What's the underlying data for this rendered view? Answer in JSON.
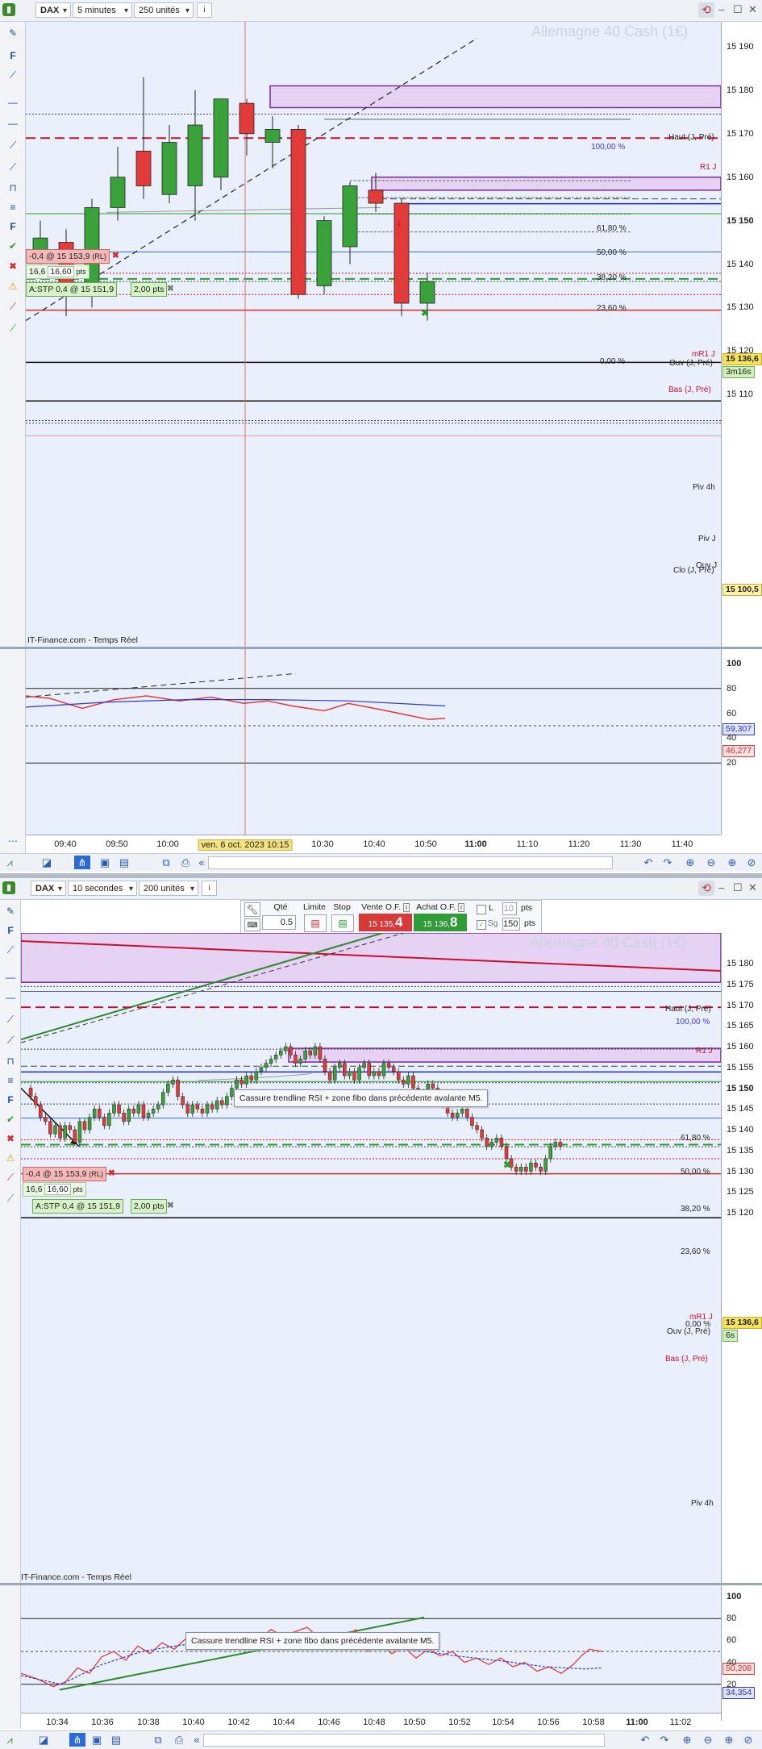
{
  "top": {
    "instrument": "DAX",
    "timeframe": "5 minutes",
    "units": "250 unités",
    "watermark": "Allemagne 40 Cash (1€)",
    "source": "IT-Finance.com - Temps Réel",
    "y_labels": [
      "15 190",
      "15 180",
      "15 170",
      "15 160",
      "15 150",
      "15 140",
      "15 130",
      "15 120",
      "15 110"
    ],
    "price_tag": "15 136,6",
    "timer_tag": "3m16s",
    "low_tag": "15 100,5",
    "levels": {
      "haut": "Haut (J, Pré)",
      "r1": "R1 J",
      "mr1": "mR1 J",
      "ouv": "Ouv (J, Pré)",
      "bas": "Bas (J, Pré)",
      "piv4h": "Piv 4h",
      "pivj": "Piv J",
      "clo": "Clo (J, Pré)",
      "ouvj": "Ouv J"
    },
    "fibo": [
      "100,00 %",
      "61,80 %",
      "50,00 %",
      "38,20 %",
      "23,60 %",
      "0,00 %"
    ],
    "order1": {
      "text": "-0,4 @ 15 153,9",
      "tag": "(RL)"
    },
    "order1b": {
      "a": "16,6",
      "b": "16,60",
      "unit": "pts"
    },
    "order2": {
      "text": "A:STP 0,4 @ 15 151,9",
      "pts": "2,00 pts"
    },
    "rsi_labels": [
      "100",
      "80",
      "60",
      "40",
      "20"
    ],
    "rsi_tags": [
      "59,307",
      "46,277"
    ],
    "x_labels": [
      "09:40",
      "09:50",
      "10:00",
      "10:30",
      "10:40",
      "10:50",
      "11:00",
      "11:10",
      "11:20",
      "11:30",
      "11:40"
    ],
    "x_cursor": "ven. 6 oct. 2023 10:15",
    "chart_data": {
      "type": "candlestick",
      "candles": [
        {
          "o": 15142,
          "h": 15150,
          "l": 15140,
          "c": 15146
        },
        {
          "o": 15145,
          "h": 15148,
          "l": 15128,
          "c": 15133
        },
        {
          "o": 15133,
          "h": 15155,
          "l": 15130,
          "c": 15153
        },
        {
          "o": 15153,
          "h": 15167,
          "l": 15150,
          "c": 15160
        },
        {
          "o": 15166,
          "h": 15183,
          "l": 15155,
          "c": 15158
        },
        {
          "o": 15156,
          "h": 15172,
          "l": 15154,
          "c": 15168
        },
        {
          "o": 15158,
          "h": 15180,
          "l": 15150,
          "c": 15172
        },
        {
          "o": 15160,
          "h": 15177,
          "l": 15157,
          "c": 15178
        },
        {
          "o": 15177,
          "h": 15178,
          "l": 15165,
          "c": 15170
        },
        {
          "o": 15168,
          "h": 15174,
          "l": 15162,
          "c": 15171
        },
        {
          "o": 15171,
          "h": 15172,
          "l": 15132,
          "c": 15133
        },
        {
          "o": 15135,
          "h": 15151,
          "l": 15133,
          "c": 15150
        },
        {
          "o": 15144,
          "h": 15159,
          "l": 15140,
          "c": 15158
        },
        {
          "o": 15157,
          "h": 15161,
          "l": 15152,
          "c": 15154
        },
        {
          "o": 15154,
          "h": 15155,
          "l": 15128,
          "c": 15131
        },
        {
          "o": 15131,
          "h": 15138,
          "l": 15127,
          "c": 15136
        }
      ]
    }
  },
  "bottom": {
    "instrument": "DAX",
    "timeframe": "10 secondes",
    "units": "200 unités",
    "qty_label": "Qté",
    "qty": "0.5",
    "limit": "Limite",
    "stop": "Stop",
    "sell_label": "Vente O.F.",
    "sell_price": "15 135,",
    "sell_big": "4",
    "buy_label": "Achat O.F.",
    "buy_price": "15 136,",
    "buy_big": "8",
    "l_label": "L",
    "l_value": "10",
    "sg_label": "Sg",
    "sg_value": "150",
    "pts": "pts",
    "watermark": "Allemagne 40 Cash (1€)",
    "source": "IT-Finance.com - Temps Réel",
    "note": "Cassure trendline RSI + zone fibo dans précédente avalante M5.",
    "y_labels": [
      "15 180",
      "15 175",
      "15 170",
      "15 165",
      "15 160",
      "15 155",
      "15 150",
      "15 145",
      "15 140",
      "15 135",
      "15 130",
      "15 125",
      "15 120"
    ],
    "price_tag": "15 136,6",
    "timer_tag": "6s",
    "rsi_labels": [
      "100",
      "80",
      "60",
      "40",
      "20"
    ],
    "rsi_tags": [
      "50,208",
      "34,354"
    ],
    "x_labels": [
      "10:34",
      "10:36",
      "10:38",
      "10:40",
      "10:42",
      "10:44",
      "10:46",
      "10:48",
      "10:50",
      "10:52",
      "10:54",
      "10:56",
      "10:58",
      "11:00",
      "11:02"
    ]
  }
}
